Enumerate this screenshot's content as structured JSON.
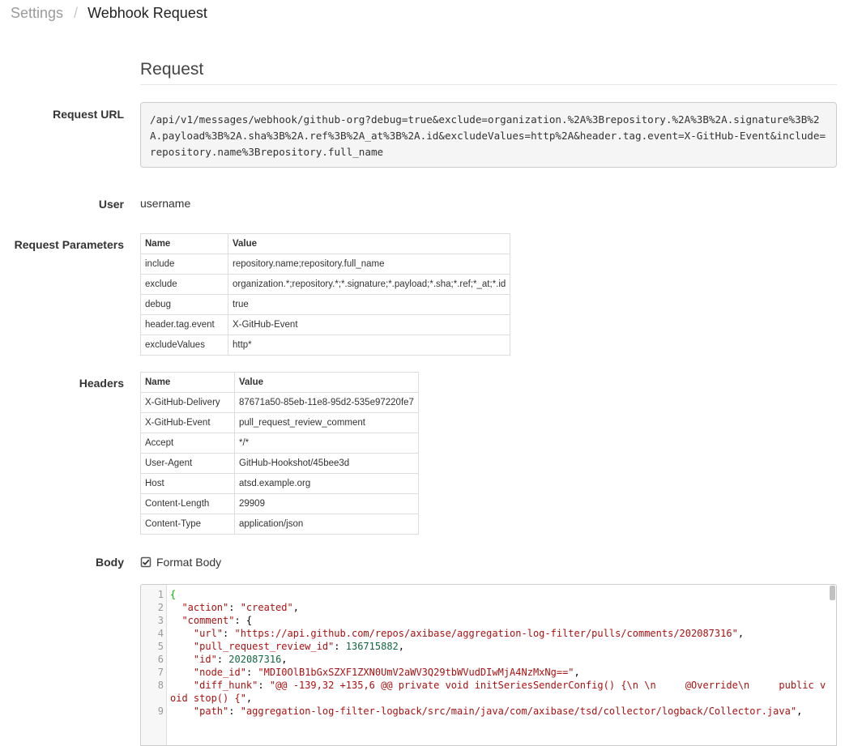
{
  "breadcrumb": {
    "parent": "Settings",
    "separator": "/",
    "current": "Webhook Request"
  },
  "section_title": "Request",
  "labels": {
    "request_url": "Request URL",
    "user": "User",
    "request_parameters": "Request Parameters",
    "headers": "Headers",
    "body": "Body"
  },
  "request_url": "/api/v1/messages/webhook/github-org?debug=true&exclude=organization.%2A%3Brepository.%2A%3B%2A.signature%3B%2A.payload%3B%2A.sha%3B%2A.ref%3B%2A_at%3B%2A.id&excludeValues=http%2A&header.tag.event=X-GitHub-Event&include=repository.name%3Brepository.full_name",
  "user": "username",
  "params_table": {
    "columns": [
      "Name",
      "Value"
    ],
    "rows": [
      [
        "include",
        "repository.name;repository.full_name"
      ],
      [
        "exclude",
        "organization.*;repository.*;*.signature;*.payload;*.sha;*.ref;*_at;*.id"
      ],
      [
        "debug",
        "true"
      ],
      [
        "header.tag.event",
        "X-GitHub-Event"
      ],
      [
        "excludeValues",
        "http*"
      ]
    ]
  },
  "headers_table": {
    "columns": [
      "Name",
      "Value"
    ],
    "rows": [
      [
        "X-GitHub-Delivery",
        "87671a50-85eb-11e8-95d2-535e97220fe7"
      ],
      [
        "X-GitHub-Event",
        "pull_request_review_comment"
      ],
      [
        "Accept",
        "*/*"
      ],
      [
        "User-Agent",
        "GitHub-Hookshot/45bee3d"
      ],
      [
        "Host",
        "atsd.example.org"
      ],
      [
        "Content-Length",
        "29909"
      ],
      [
        "Content-Type",
        "application/json"
      ]
    ]
  },
  "format_body": {
    "label": "Format Body",
    "checked": true
  },
  "body_lines": [
    {
      "n": "1",
      "parts": [
        [
          "b",
          "{"
        ]
      ]
    },
    {
      "n": "2",
      "parts": [
        [
          "",
          "  "
        ],
        [
          "k",
          "\"action\""
        ],
        [
          "",
          ": "
        ],
        [
          "s",
          "\"created\""
        ],
        [
          "",
          ","
        ]
      ]
    },
    {
      "n": "3",
      "parts": [
        [
          "",
          "  "
        ],
        [
          "k",
          "\"comment\""
        ],
        [
          "",
          ": {"
        ]
      ]
    },
    {
      "n": "4",
      "parts": [
        [
          "",
          "    "
        ],
        [
          "k",
          "\"url\""
        ],
        [
          "",
          ": "
        ],
        [
          "s",
          "\"https://api.github.com/repos/axibase/aggregation-log-filter/pulls/comments/202087316\""
        ],
        [
          "",
          ","
        ]
      ]
    },
    {
      "n": "5",
      "parts": [
        [
          "",
          "    "
        ],
        [
          "k",
          "\"pull_request_review_id\""
        ],
        [
          "",
          ": "
        ],
        [
          "n",
          "136715882"
        ],
        [
          "",
          ","
        ]
      ]
    },
    {
      "n": "6",
      "parts": [
        [
          "",
          "    "
        ],
        [
          "k",
          "\"id\""
        ],
        [
          "",
          ": "
        ],
        [
          "n",
          "202087316"
        ],
        [
          "",
          ","
        ]
      ]
    },
    {
      "n": "7",
      "parts": [
        [
          "",
          "    "
        ],
        [
          "k",
          "\"node_id\""
        ],
        [
          "",
          ": "
        ],
        [
          "s",
          "\"MDI0OlB1bGxSZXF1ZXN0UmV2aWV3Q29tbWVudDIwMjA4NzMxNg==\""
        ],
        [
          "",
          ","
        ]
      ]
    },
    {
      "n": "8",
      "parts": [
        [
          "",
          "    "
        ],
        [
          "k",
          "\"diff_hunk\""
        ],
        [
          "",
          ": "
        ],
        [
          "s",
          "\"@@ -139,32 +135,6 @@ private void initSeriesSenderConfig() {\\n \\n     @Override\\n     public void stop() {\""
        ],
        [
          "",
          ","
        ]
      ]
    },
    {
      "n": "9",
      "parts": [
        [
          "",
          "    "
        ],
        [
          "k",
          "\"path\""
        ],
        [
          "",
          ": "
        ],
        [
          "s",
          "\"aggregation-log-filter-logback/src/main/java/com/axibase/tsd/collector/logback/Collector.java\""
        ],
        [
          "",
          ","
        ]
      ]
    }
  ]
}
